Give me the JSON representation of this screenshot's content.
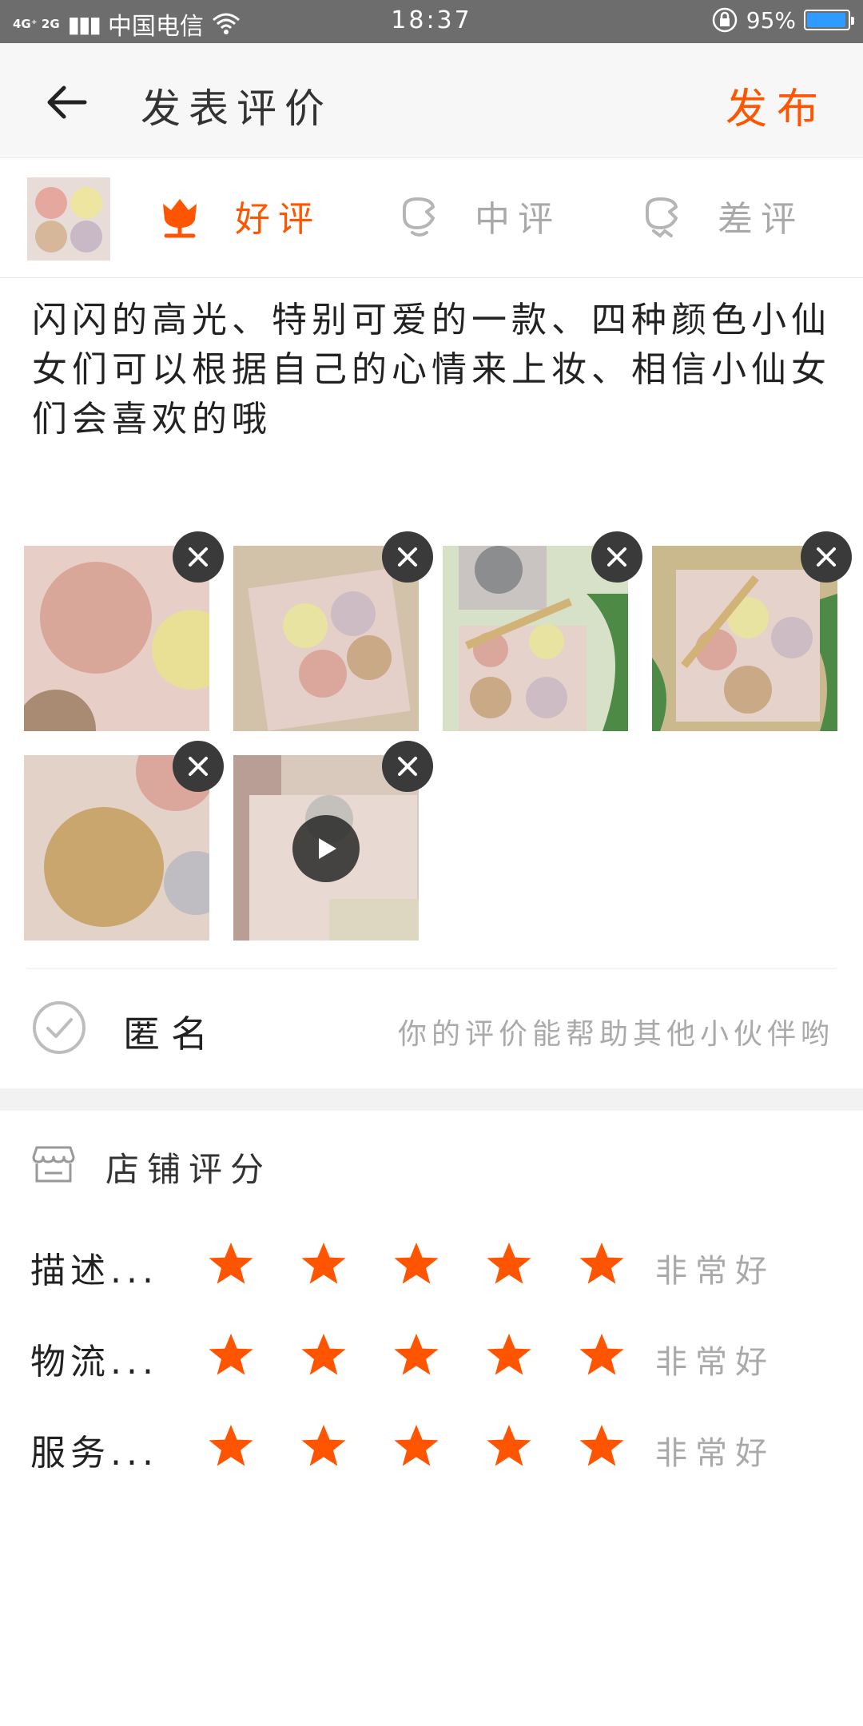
{
  "status_bar": {
    "network": "4G⁺ 2G",
    "carrier": "中国电信",
    "time": "18:37",
    "battery": "95%",
    "battery_level": 0.95
  },
  "header": {
    "title": "发表评价",
    "publish_label": "发布"
  },
  "rating": {
    "options": [
      {
        "label": "好评",
        "selected": true
      },
      {
        "label": "中评",
        "selected": false
      },
      {
        "label": "差评",
        "selected": false
      }
    ]
  },
  "review": {
    "text": "闪闪的高光、特别可爱的一款、四种颜色小仙女们可以根据自己的心情来上妆、相信小仙女们会喜欢的哦"
  },
  "media": {
    "photo_count": 5,
    "video_count": 1
  },
  "anonymous": {
    "label": "匿名",
    "hint": "你的评价能帮助其他小伙伴哟"
  },
  "shop_rating": {
    "title": "店铺评分",
    "rows": [
      {
        "label": "描述...",
        "stars": 5,
        "text": "非常好"
      },
      {
        "label": "物流...",
        "stars": 5,
        "text": "非常好"
      },
      {
        "label": "服务...",
        "stars": 5,
        "text": "非常好"
      }
    ]
  },
  "colors": {
    "accent": "#ff5500",
    "status_bar": "#6d6d6d",
    "muted_text": "#a9a9a9"
  }
}
